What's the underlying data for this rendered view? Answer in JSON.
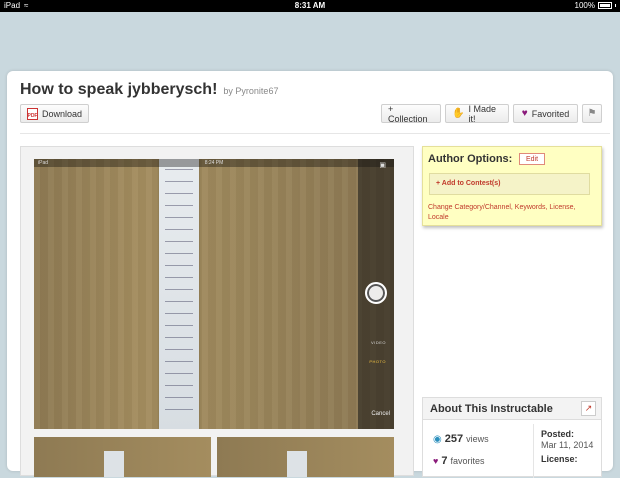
{
  "statusbar": {
    "device": "iPad",
    "time": "8:31 AM",
    "battery": "100%"
  },
  "page": {
    "title": "How to speak jybberysch!",
    "by_prefix": "by",
    "author": "Pyronite67"
  },
  "toolbar": {
    "download_label": "Download",
    "pdf_icon_text": "PDF",
    "collection_label": "+ Collection",
    "made_label": "I Made it!",
    "favorited_label": "Favorited"
  },
  "camera": {
    "device": "iPad",
    "time": "8:24 PM",
    "video_label": "VIDEO",
    "photo_label": "PHOTO",
    "cancel_label": "Cancel"
  },
  "author_options": {
    "title": "Author Options:",
    "edit_label": "Edit",
    "contest_link": "+ Add to Contest(s)",
    "change_links": "Change Category/Channel, Keywords, License, Locale"
  },
  "about": {
    "title": "About This Instructable",
    "views_count": "257",
    "views_label": "views",
    "favorites_count": "7",
    "favorites_label": "favorites",
    "posted_label": "Posted:",
    "posted_date": "Mar 11, 2014",
    "license_label": "License:"
  },
  "colors": {
    "accent_link": "#c0392b",
    "heart": "#8a1a7a",
    "author_box_bg": "#ffffc2"
  }
}
